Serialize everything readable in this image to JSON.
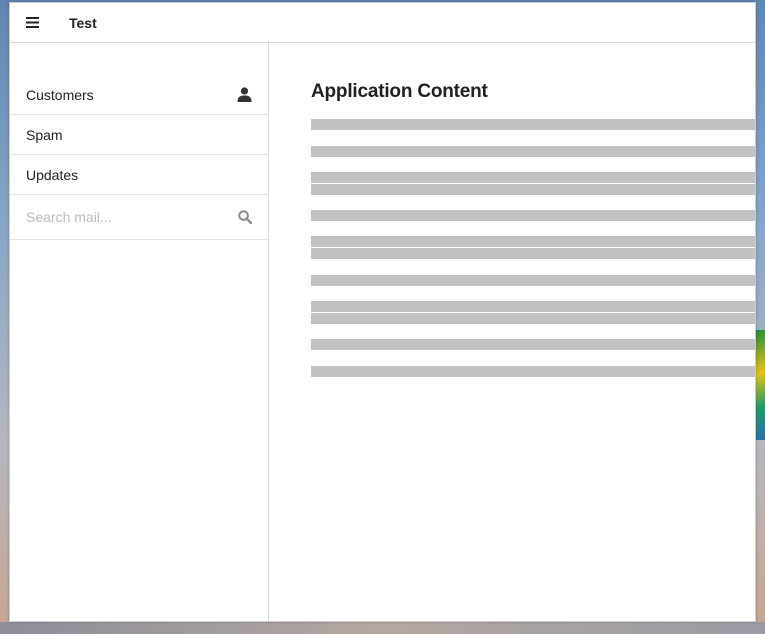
{
  "header": {
    "title": "Test",
    "menu_icon": "hamburger-icon"
  },
  "sidebar": {
    "items": [
      {
        "label": "Customers",
        "icon": "user-icon"
      },
      {
        "label": "Spam"
      },
      {
        "label": "Updates"
      }
    ],
    "search": {
      "placeholder": "Search mail...",
      "value": "",
      "icon": "search-icon"
    }
  },
  "main": {
    "heading": "Application Content"
  },
  "colors": {
    "placeholder_bar": "#c2c2c4",
    "text": "#222222",
    "divider": "#e3e3e3"
  }
}
